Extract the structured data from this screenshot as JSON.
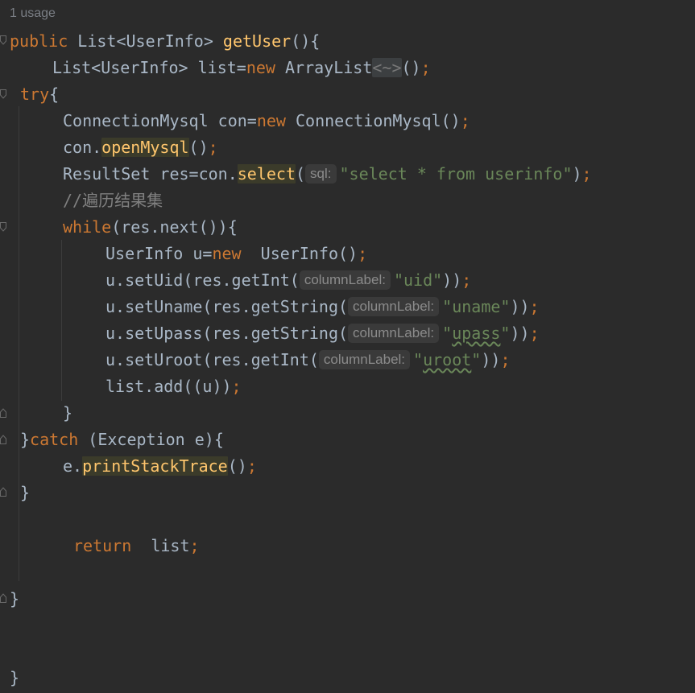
{
  "editor": {
    "usage_hint": "1 usage",
    "lines": {
      "l1": {
        "kw_public": "public",
        "t_type": " List<UserInfo> ",
        "fn_name": "getUser",
        "t_end": "(){"
      },
      "l2": {
        "t_a": "List<UserInfo> list=",
        "kw_new": "new",
        "t_b": " ArrayList",
        "diamond": "<~>",
        "t_c": "()",
        "semi": ";"
      },
      "l3": {
        "kw_try": "try",
        "t_brace": "{"
      },
      "l4": {
        "t_a": "ConnectionMysql con=",
        "kw_new": "new",
        "t_b": " ConnectionMysql()",
        "semi": ";"
      },
      "l5": {
        "t_a": "con.",
        "method": "openMysql",
        "t_b": "()",
        "semi": ";"
      },
      "l6": {
        "t_a": "ResultSet res=con.",
        "method": "select",
        "t_paren": "(",
        "hint": "sql:",
        "str": "\"select * from userinfo\"",
        "t_close": ")",
        "semi": ";"
      },
      "l7": {
        "comment": "//遍历结果集"
      },
      "l8": {
        "kw_while": "while",
        "t_rest": "(res.next()){"
      },
      "l9": {
        "t_a": "UserInfo u=",
        "kw_new": "new",
        "t_b": "  UserInfo()",
        "semi": ";"
      },
      "l10": {
        "t_a": "u.setUid(res.getInt(",
        "hint": "columnLabel:",
        "str": "\"uid\"",
        "t_close": "))",
        "semi": ";"
      },
      "l11": {
        "t_a": "u.setUname(res.getString(",
        "hint": "columnLabel:",
        "str": "\"uname\"",
        "t_close": "))",
        "semi": ";"
      },
      "l12": {
        "t_a": "u.setUpass(res.getString(",
        "hint": "columnLabel:",
        "str_q1": "\"",
        "str_word": "upass",
        "str_q2": "\"",
        "t_close": "))",
        "semi": ";"
      },
      "l13": {
        "t_a": "u.setUroot(res.getInt(",
        "hint": "columnLabel:",
        "str_q1": "\"",
        "str_word": "uroot",
        "str_q2": "\"",
        "t_close": "))",
        "semi": ";"
      },
      "l14": {
        "t_a": "list.add((u))",
        "semi": ";"
      },
      "l15": {
        "t_brace": "}"
      },
      "l16": {
        "t_open": "}",
        "kw_catch": "catch",
        "t_rest": " (Exception e){"
      },
      "l17": {
        "t_a": "e.",
        "method": "printStackTrace",
        "t_b": "()",
        "semi": ";"
      },
      "l18": {
        "t_brace": "}"
      },
      "l19": {
        "kw_return": "return",
        "t_rest": "  list",
        "semi": ";"
      },
      "l20": {
        "t_brace": "}"
      },
      "l21": {
        "t_brace": "}"
      }
    }
  },
  "colors": {
    "background": "#2b2b2b",
    "keyword": "#cc7832",
    "function": "#ffc66d",
    "string": "#6a8759",
    "comment": "#808080",
    "text": "#a9b7c6"
  }
}
